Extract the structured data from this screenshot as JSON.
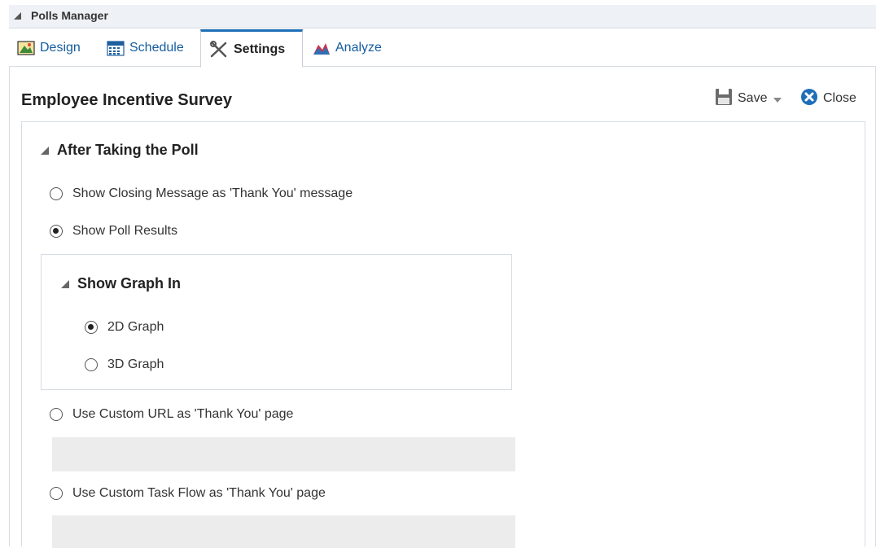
{
  "header": {
    "title": "Polls Manager"
  },
  "tabs": [
    {
      "label": "Design",
      "icon": "design-icon",
      "active": false
    },
    {
      "label": "Schedule",
      "icon": "calendar-icon",
      "active": false
    },
    {
      "label": "Settings",
      "icon": "tools-icon",
      "active": true
    },
    {
      "label": "Analyze",
      "icon": "chart-icon",
      "active": false
    }
  ],
  "toolbar": {
    "title": "Employee Incentive Survey",
    "save_label": "Save",
    "close_label": "Close"
  },
  "after_poll": {
    "heading": "After Taking the Poll",
    "options": [
      {
        "label": "Show Closing Message as 'Thank You' message",
        "selected": false
      },
      {
        "label": "Show Poll Results",
        "selected": true
      },
      {
        "label": "Use Custom URL as 'Thank You' page",
        "selected": false,
        "value": ""
      },
      {
        "label": "Use Custom Task Flow as 'Thank You' page",
        "selected": false,
        "value": ""
      }
    ]
  },
  "graph": {
    "heading": "Show Graph In",
    "options": [
      {
        "label": "2D Graph",
        "selected": true
      },
      {
        "label": "3D Graph",
        "selected": false
      }
    ]
  },
  "colors": {
    "accent": "#1e6fb8",
    "link": "#145c9e",
    "close": "#1e6fb8"
  }
}
